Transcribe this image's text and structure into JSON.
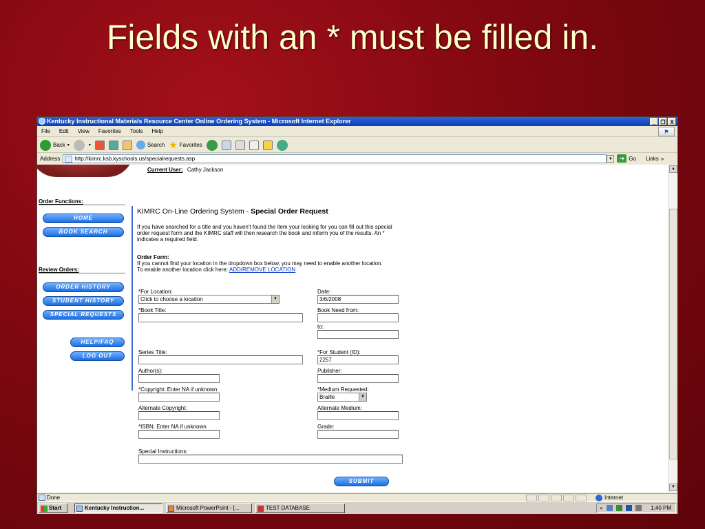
{
  "slide": {
    "title": "Fields with an * must be filled in."
  },
  "window": {
    "title": "Kentucky Instructional Materials Resource Center Online Ordering System - Microsoft Internet Explorer",
    "buttons": [
      "_",
      "❐",
      "X"
    ]
  },
  "menu": [
    "File",
    "Edit",
    "View",
    "Favorites",
    "Tools",
    "Help"
  ],
  "toolbar": {
    "back": "Back",
    "search": "Search",
    "favorites": "Favorites"
  },
  "address": {
    "label": "Address",
    "url": "http://kimrc.ksb.kyschools.us/specialrequests.asp",
    "go": "Go",
    "links": "Links"
  },
  "page": {
    "current_user_label": "Current User:",
    "current_user": "Cathy Jackson",
    "order_functions": "Order Functions:",
    "review_orders": "Review Orders:",
    "nav": {
      "home": "HOME",
      "book_search": "BOOK SEARCH",
      "order_history": "ORDER HISTORY",
      "student_history": "STUDENT HISTORY",
      "special_requests": "SPECIAL REQUESTS",
      "help": "HELP/FAQ",
      "logout": "LOG OUT"
    },
    "title_prefix": "KIMRC On-Line Ordering System - ",
    "title_bold": "Special Order Request",
    "intro": "If you have searched for a title and you haven't found the item your looking for you can fill out this special order request form and the KIMRC staff will then research the book and inform you of the results. An * indicates a required field.",
    "order_form_heading": "Order Form:",
    "order_form_text1": "If you cannot find your location in the dropdown box below, you may need to enable another location.",
    "order_form_text2": "To enable another location click here: ",
    "order_form_link": "ADD/REMOVE LOCATION",
    "form": {
      "for_location_label": "*For Location:",
      "for_location_value": "Click to choose a location",
      "date_label": "Date:",
      "date_value": "3/6/2008",
      "book_title_label": "*Book Title:",
      "book_need_from_label": "Book Need from:",
      "to_label": "to:",
      "series_title_label": "Series Title:",
      "for_student_label": "*For Student (ID):",
      "for_student_value": "2257",
      "authors_label": "Author(s):",
      "publisher_label": "Publisher:",
      "copyright_label": "*Copyright: Enter NA if unknown",
      "medium_label": "*Medium Requested:",
      "medium_value": "Braille",
      "alt_copyright_label": "Alternate Copyright:",
      "alt_medium_label": "Alternate Medium:",
      "isbn_label": "*ISBN: Enter NA if unknown",
      "grade_label": "Grade:",
      "special_instructions_label": "Special Instructions:",
      "submit": "SUBMIT"
    }
  },
  "status": {
    "text": "Done",
    "zone": "Internet"
  },
  "taskbar": {
    "start": "Start",
    "tasks": [
      "Kentucky Instruction...",
      "Microsoft PowerPoint - [...",
      "TEST DATABASE"
    ],
    "clock": "1:40 PM"
  }
}
